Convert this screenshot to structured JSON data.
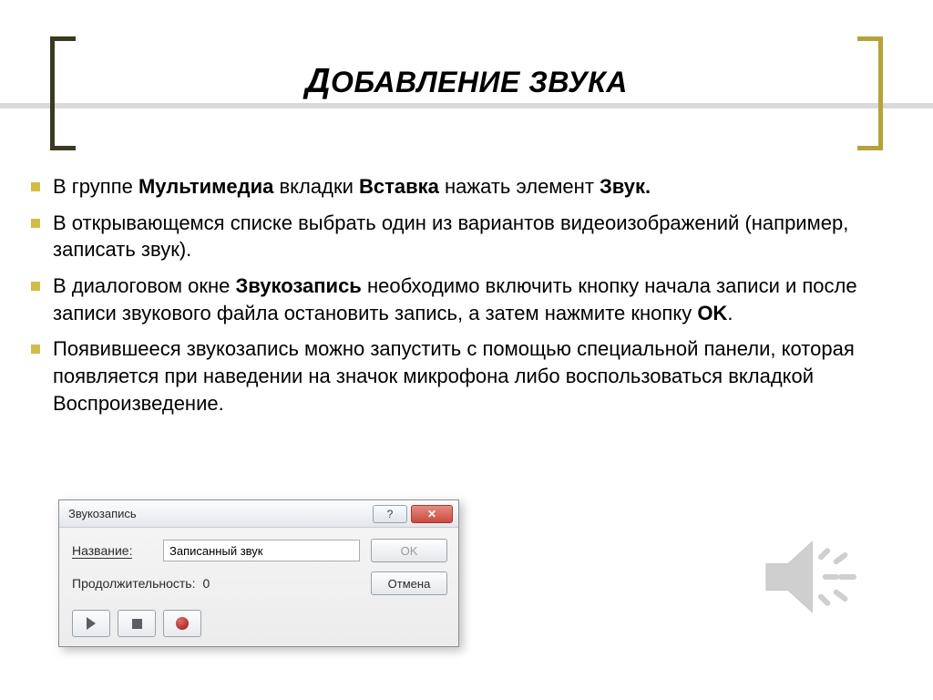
{
  "title": {
    "leading": "Д",
    "rest": "ОБАВЛЕНИЕ ЗВУКА"
  },
  "bullets": [
    {
      "pre": "В группе ",
      "b1": "Мультимедиа",
      "mid1": " вкладки ",
      "b2": "Вставка",
      "mid2": " нажать элемент ",
      "b3": "Звук.",
      "post": ""
    },
    {
      "text": "В открывающемся списке выбрать один из вариантов видеоизображений (например, записать звук)."
    },
    {
      "pre": "В диалоговом окне ",
      "b1": "Звукозапись",
      "mid1": " необходимо включить кнопку начала записи и после записи звукового файла остановить запись, а затем нажмите кнопку ",
      "b2": "OK",
      "post": "."
    },
    {
      "text": "Появившееся звукозапись можно запустить с помощью специальной панели, которая появляется при наведении на значок микрофона либо воспользоваться вкладкой Воспроизведение."
    }
  ],
  "dialog": {
    "title": "Звукозапись",
    "help_symbol": "?",
    "close_symbol": "✕",
    "name_label": "Название:",
    "name_value": "Записанный звук",
    "duration_label": "Продолжительность:",
    "duration_value": "0",
    "ok_label": "OK",
    "cancel_label": "Отмена"
  }
}
